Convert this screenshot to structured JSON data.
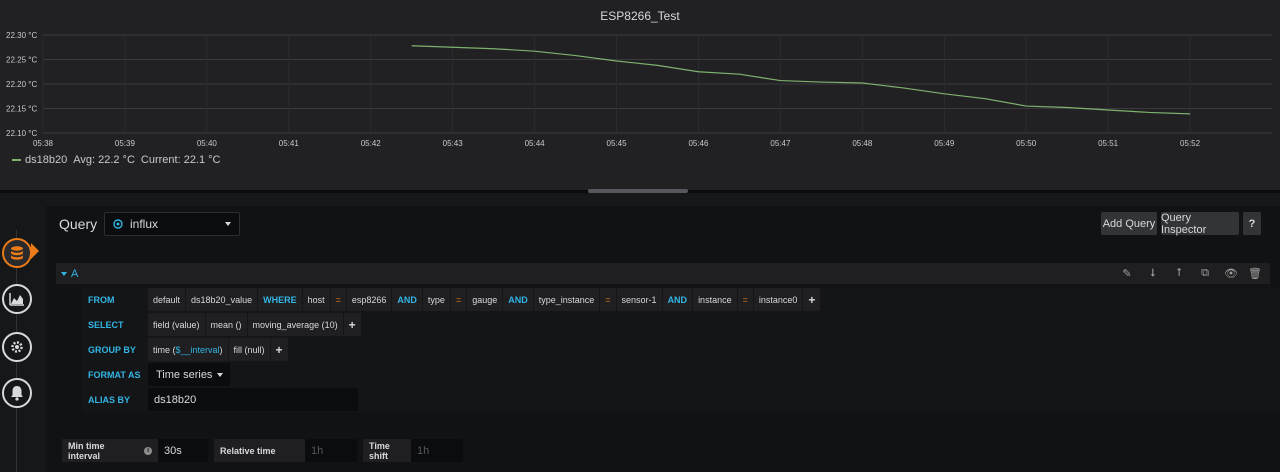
{
  "panel": {
    "title": "ESP8266_Test"
  },
  "chart_data": {
    "type": "line",
    "title": "ESP8266_Test",
    "x_ticks": [
      "05:38",
      "05:39",
      "05:40",
      "05:41",
      "05:42",
      "05:43",
      "05:44",
      "05:45",
      "05:46",
      "05:47",
      "05:48",
      "05:49",
      "05:50",
      "05:51",
      "05:52"
    ],
    "y_ticks": [
      "22.10 °C",
      "22.15 °C",
      "22.20 °C",
      "22.25 °C",
      "22.30 °C"
    ],
    "ylim": [
      22.1,
      22.3
    ],
    "xlim_minutes": [
      "05:38",
      "05:53"
    ],
    "grid": true,
    "color": "#7eb26d",
    "series": [
      {
        "name": "ds18b20",
        "x": [
          "05:42:30",
          "05:43:00",
          "05:43:30",
          "05:44:00",
          "05:44:30",
          "05:45:00",
          "05:45:30",
          "05:46:00",
          "05:46:30",
          "05:47:00",
          "05:47:30",
          "05:48:00",
          "05:48:30",
          "05:49:00",
          "05:49:30",
          "05:50:00",
          "05:50:30",
          "05:51:00",
          "05:51:30",
          "05:52:00"
        ],
        "values": [
          22.278,
          22.275,
          22.272,
          22.267,
          22.258,
          22.247,
          22.238,
          22.225,
          22.22,
          22.207,
          22.204,
          22.202,
          22.192,
          22.18,
          22.17,
          22.155,
          22.152,
          22.147,
          22.142,
          22.139
        ]
      }
    ]
  },
  "legend": {
    "series_name": "ds18b20",
    "avg": "Avg: 22.2 °C",
    "current": "Current: 22.1 °C"
  },
  "editor": {
    "query_label": "Query",
    "datasource": "influx",
    "add_query": "Add Query",
    "query_inspector": "Query Inspector",
    "help": "?",
    "row_letter": "A"
  },
  "query": {
    "from_kw": "FROM",
    "from": {
      "policy": "default",
      "measurement": "ds18b20_value",
      "where_kw": "WHERE",
      "conditions": [
        {
          "key": "host",
          "op": "=",
          "value": "esp8266",
          "join": "AND"
        },
        {
          "key": "type",
          "op": "=",
          "value": "gauge",
          "join": "AND"
        },
        {
          "key": "type_instance",
          "op": "=",
          "value": "sensor-1",
          "join": "AND"
        },
        {
          "key": "instance",
          "op": "=",
          "value": "instance0"
        }
      ],
      "plus": "+"
    },
    "select_kw": "SELECT",
    "select": [
      "field (value)",
      "mean ()",
      "moving_average (10)"
    ],
    "group_by_kw": "GROUP BY",
    "group_by": {
      "time_prefix": "time (",
      "time_var": "$__interval",
      "time_suffix": ")",
      "fill": "fill (null)"
    },
    "format_as_kw": "FORMAT AS",
    "format_as": "Time series",
    "alias_by_kw": "ALIAS BY",
    "alias_by": "ds18b20"
  },
  "options": {
    "min_interval_label": "Min time interval",
    "min_interval_value": "30s",
    "relative_time_label": "Relative time",
    "relative_time_placeholder": "1h",
    "time_shift_label": "Time shift",
    "time_shift_placeholder": "1h",
    "info": "i"
  }
}
